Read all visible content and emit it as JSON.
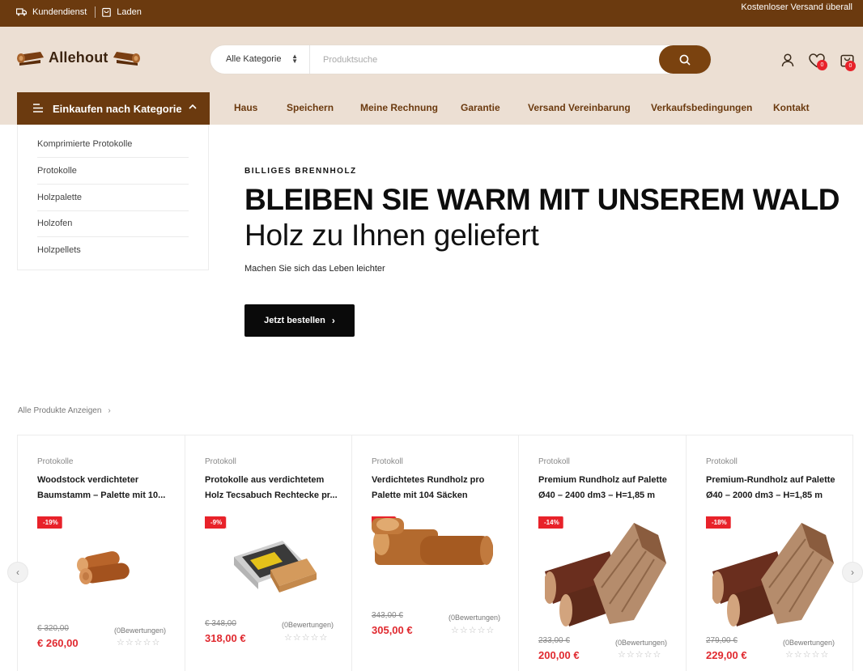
{
  "topbar": {
    "service_label": "Kundendienst",
    "store_label": "Laden",
    "shipping_text": "Kostenloser Versand überall"
  },
  "header": {
    "logo_text": "Allehout",
    "search": {
      "category_value": "Alle Kategorie",
      "placeholder": "Produktsuche"
    },
    "wishlist_count": "0",
    "cart_count": "0"
  },
  "nav": {
    "category_button": "Einkaufen nach Kategorie",
    "items": [
      "Haus",
      "Speichern",
      "Meine Rechnung",
      "Garantie",
      "Versand Vereinbarung",
      "Verkaufsbedingungen",
      "Kontakt"
    ]
  },
  "categories": [
    "Komprimierte Protokolle",
    "Protokolle",
    "Holzpalette",
    "Holzofen",
    "Holzpellets"
  ],
  "hero": {
    "subtitle": "BILLIGES BRENNHOLZ",
    "title": "BLEIBEN SIE WARM MIT UNSEREM WALD",
    "title2": "Holz zu Ihnen geliefert",
    "text": "Machen Sie sich das Leben leichter",
    "button": "Jetzt bestellen"
  },
  "all_products_link": "Alle Produkte Anzeigen",
  "products": [
    {
      "category": "Protokolle",
      "name": "Woodstock verdichteter Baumstamm – Palette mit 10...",
      "discount": "-19%",
      "old_price": "€ 320,00",
      "price": "€ 260,00",
      "reviews": "(0Bewertungen)",
      "rating": 0
    },
    {
      "category": "Protokoll",
      "name": "Protokolle aus verdichtetem Holz Tecsabuch Rechtecke pr...",
      "discount": "-9%",
      "old_price": "€ 348,00",
      "price": "318,00 €",
      "reviews": "(0Bewertungen)",
      "rating": 0
    },
    {
      "category": "Protokoll",
      "name": "Verdichtetes Rundholz pro Palette mit 104 Säcken",
      "discount": "-11%",
      "old_price": "343,00 €",
      "price": "305,00 €",
      "reviews": "(0Bewertungen)",
      "rating": 0
    },
    {
      "category": "Protokoll",
      "name": "Premium Rundholz auf Palette Ø40 – 2400 dm3 – H=1,85 m",
      "discount": "-14%",
      "old_price": "233,00 €",
      "price": "200,00 €",
      "reviews": "(0Bewertungen)",
      "rating": 0
    },
    {
      "category": "Protokoll",
      "name": "Premium-Rundholz auf Palette Ø40 – 2000 dm3 – H=1,85 m",
      "discount": "-18%",
      "old_price": "279,00 €",
      "price": "229,00 €",
      "reviews": "(0Bewertungen)",
      "rating": 0
    }
  ],
  "colors": {
    "brand_brown": "#6b3a0f",
    "header_bg": "#ecdfd3",
    "sale_red": "#e8222a"
  }
}
